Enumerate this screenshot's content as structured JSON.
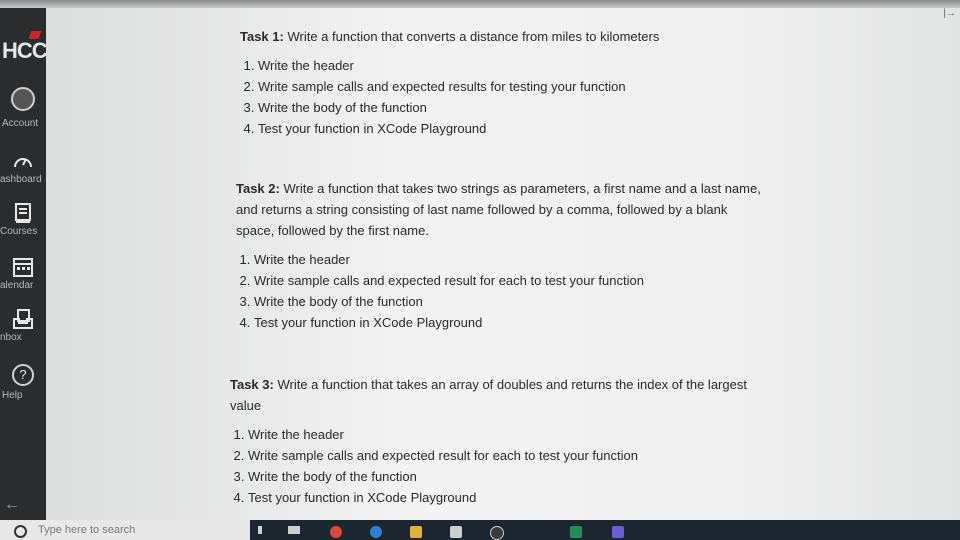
{
  "sidebar": {
    "logo": "HCC",
    "items": [
      {
        "label": "Account",
        "icon": "account-avatar-icon"
      },
      {
        "label": "ashboard",
        "icon": "dashboard-gauge-icon"
      },
      {
        "label": "Courses",
        "icon": "courses-book-icon"
      },
      {
        "label": "alendar",
        "icon": "calendar-icon"
      },
      {
        "label": "nbox",
        "icon": "inbox-icon"
      },
      {
        "label": "Help",
        "icon": "help-icon"
      }
    ],
    "collapse_icon": "collapse-arrow-icon"
  },
  "tasks": [
    {
      "title": "Task 1:",
      "description": "Write a function that converts a distance from miles to kilometers",
      "steps": [
        "Write the header",
        "Write sample calls and expected results for testing your function",
        "Write the body of the function",
        "Test your function in XCode Playground"
      ]
    },
    {
      "title": "Task 2:",
      "description": "Write a function that takes two strings as parameters, a first name and a last name, and returns a string consisting of last name followed by a comma, followed by a blank space, followed by the first name.",
      "steps": [
        "Write the header",
        "Write sample calls and expected result for each to test your function",
        "Write the body of the function",
        "Test your function in XCode Playground"
      ]
    },
    {
      "title": "Task 3:",
      "description": "Write a function that takes an array of doubles and returns the index of the largest value",
      "steps": [
        "Write the header",
        "Write sample calls and expected result for each to test your function",
        "Write the body of the function",
        "Test your function in XCode Playground"
      ]
    }
  ],
  "taskbar": {
    "search_placeholder": "Type here to search"
  },
  "colors": {
    "sidebar_bg": "#2a2c2e",
    "logo_accent": "#c8262c",
    "taskbar_bg": "#1b2630"
  }
}
